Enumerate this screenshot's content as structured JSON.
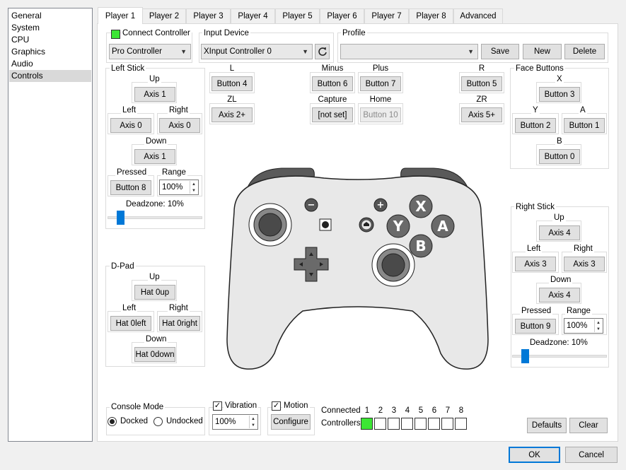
{
  "sidebar": {
    "items": [
      {
        "label": "General"
      },
      {
        "label": "System"
      },
      {
        "label": "CPU"
      },
      {
        "label": "Graphics"
      },
      {
        "label": "Audio"
      },
      {
        "label": "Controls"
      }
    ]
  },
  "tabs": [
    {
      "label": "Player 1"
    },
    {
      "label": "Player 2"
    },
    {
      "label": "Player 3"
    },
    {
      "label": "Player 4"
    },
    {
      "label": "Player 5"
    },
    {
      "label": "Player 6"
    },
    {
      "label": "Player 7"
    },
    {
      "label": "Player 8"
    },
    {
      "label": "Advanced"
    }
  ],
  "connect": {
    "label": "Connect Controller",
    "type": "Pro Controller",
    "indicator_color": "#3ce634"
  },
  "input_device": {
    "label": "Input Device",
    "value": "XInput Controller 0",
    "refresh_icon": "refresh-icon"
  },
  "profile": {
    "label": "Profile",
    "value": "",
    "save": "Save",
    "new": "New",
    "delete": "Delete"
  },
  "left_stick": {
    "title": "Left Stick",
    "up_label": "Up",
    "up": "Axis 1",
    "left_label": "Left",
    "left": "Axis 0",
    "right_label": "Right",
    "right": "Axis 0",
    "down_label": "Down",
    "down": "Axis 1",
    "pressed_label": "Pressed",
    "pressed": "Button 8",
    "range_label": "Range",
    "range": "100%",
    "deadzone": "Deadzone: 10%"
  },
  "dpad": {
    "title": "D-Pad",
    "up_label": "Up",
    "up": "Hat 0up",
    "left_label": "Left",
    "left": "Hat 0left",
    "right_label": "Right",
    "right": "Hat 0right",
    "down_label": "Down",
    "down": "Hat 0down"
  },
  "center": {
    "l_label": "L",
    "l": "Button 4",
    "zl_label": "ZL",
    "zl": "Axis 2+",
    "minus_label": "Minus",
    "minus": "Button 6",
    "plus_label": "Plus",
    "plus": "Button 7",
    "capture_label": "Capture",
    "capture": "[not set]",
    "home_label": "Home",
    "home": "Button 10",
    "r_label": "R",
    "r": "Button 5",
    "zr_label": "ZR",
    "zr": "Axis 5+"
  },
  "face": {
    "title": "Face Buttons",
    "x_label": "X",
    "x": "Button 3",
    "y_label": "Y",
    "y": "Button 2",
    "a_label": "A",
    "a": "Button 1",
    "b_label": "B",
    "b": "Button 0"
  },
  "right_stick": {
    "title": "Right Stick",
    "up_label": "Up",
    "up": "Axis 4",
    "left_label": "Left",
    "left": "Axis 3",
    "right_label": "Right",
    "right": "Axis 3",
    "down_label": "Down",
    "down": "Axis 4",
    "pressed_label": "Pressed",
    "pressed": "Button 9",
    "range_label": "Range",
    "range": "100%",
    "deadzone": "Deadzone: 10%"
  },
  "controller_glyphs": {
    "x": "X",
    "y": "Y",
    "a": "A",
    "b": "B",
    "minus": "−",
    "plus": "+"
  },
  "console_mode": {
    "title": "Console Mode",
    "docked": "Docked",
    "undocked": "Undocked",
    "selected": "Docked"
  },
  "vibration": {
    "label": "Vibration",
    "checked": true,
    "value": "100%"
  },
  "motion": {
    "label": "Motion",
    "checked": true,
    "configure": "Configure"
  },
  "connected": {
    "label1": "Connected",
    "label2": "Controllers",
    "numbers": [
      "1",
      "2",
      "3",
      "4",
      "5",
      "6",
      "7",
      "8"
    ],
    "states": [
      true,
      false,
      false,
      false,
      false,
      false,
      false,
      false
    ],
    "on_color": "#3ce634"
  },
  "footer": {
    "defaults": "Defaults",
    "clear": "Clear",
    "ok": "OK",
    "cancel": "Cancel"
  }
}
